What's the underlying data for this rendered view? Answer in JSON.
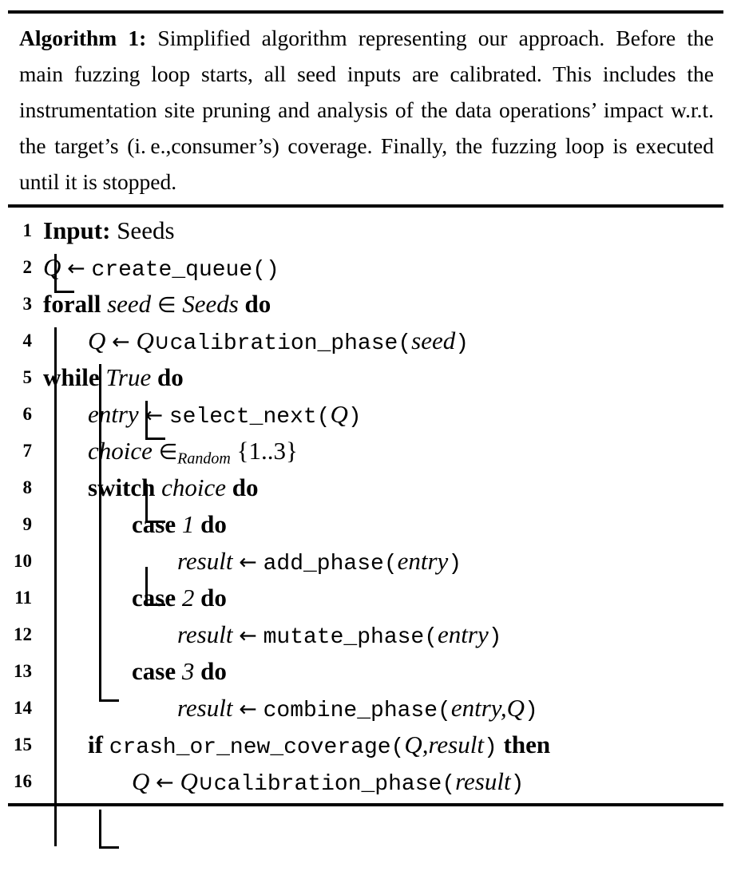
{
  "caption": {
    "label": "Algorithm 1:",
    "text": " Simplified algorithm representing our ap­proach. Before the main fuzzing loop starts, all seed inputs are calibrated. This includes the instrumentation site prun­ing and analysis of the data operations’ impact w.r.t. the target’s (i. e.,consumer’s) coverage. Finally, the fuzzing loop is executed until it is stopped."
  },
  "lines": {
    "n1": "1",
    "n2": "2",
    "n3": "3",
    "n4": "4",
    "n5": "5",
    "n6": "6",
    "n7": "7",
    "n8": "8",
    "n9": "9",
    "n10": "10",
    "n11": "11",
    "n12": "12",
    "n13": "13",
    "n14": "14",
    "n15": "15",
    "n16": "16"
  },
  "code": {
    "l1_kw": "Input:",
    "l1_arg": "Seeds",
    "l2_lhs": "Q",
    "l2_arrow": "←",
    "l2_fn": "create_queue()",
    "l3_kw": "forall",
    "l3_var": "seed",
    "l3_in": "∈",
    "l3_set": "Seeds",
    "l3_do": "do",
    "l4_lhs": "Q",
    "l4_arrow": "←",
    "l4_q": "Q",
    "l4_cup": "∪",
    "l4_fn": "calibration_phase(",
    "l4_arg": "seed",
    "l4_close": ")",
    "l5_kw": "while",
    "l5_cond": "True",
    "l5_do": "do",
    "l6_lhs": "entry",
    "l6_arrow": "←",
    "l6_fn": "select_next(",
    "l6_arg": "Q",
    "l6_close": ")",
    "l7_lhs": "choice",
    "l7_in": "∈",
    "l7_sub": "Random",
    "l7_set": "{1..3}",
    "l8_kw": "switch",
    "l8_var": "choice",
    "l8_do": "do",
    "l9_kw": "case",
    "l9_val": "1",
    "l9_do": "do",
    "l10_lhs": "result",
    "l10_arrow": "←",
    "l10_fn": "add_phase(",
    "l10_arg": "entry",
    "l10_close": ")",
    "l11_kw": "case",
    "l11_val": "2",
    "l11_do": "do",
    "l12_lhs": "result",
    "l12_arrow": "←",
    "l12_fn": "mutate_phase(",
    "l12_arg": "entry",
    "l12_close": ")",
    "l13_kw": "case",
    "l13_val": "3",
    "l13_do": "do",
    "l14_lhs": "result",
    "l14_arrow": "←",
    "l14_fn": "combine_phase(",
    "l14_arg1": "entry",
    "l14_comma": ",",
    "l14_arg2": "Q",
    "l14_close": ")",
    "l15_kw": "if",
    "l15_fn": "crash_or_new_coverage(",
    "l15_arg1": "Q",
    "l15_comma": ",",
    "l15_arg2": "result",
    "l15_close": ")",
    "l15_then": "then",
    "l16_lhs": "Q",
    "l16_arrow": "←",
    "l16_q": "Q",
    "l16_cup": "∪",
    "l16_fn": "calibration_phase(",
    "l16_arg": "result",
    "l16_close": ")"
  }
}
